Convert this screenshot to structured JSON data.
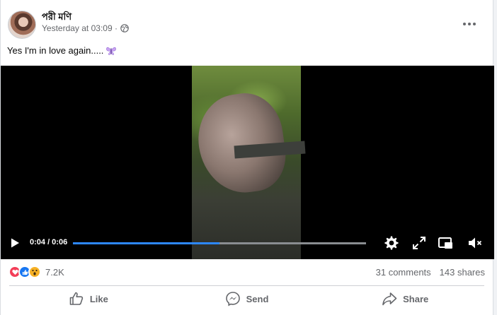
{
  "post": {
    "author": "পরী মণি",
    "timestamp": "Yesterday at 03:09 ·",
    "audience_icon": "globe-icon",
    "text": "Yes I'm in love again.....",
    "emoji": "butterfly"
  },
  "video": {
    "time": "0:04 / 0:06",
    "progress": 0.5,
    "buffered": 1.0,
    "colors": {
      "progress": "#2d88ff",
      "track": "#8a8d91"
    }
  },
  "engagement": {
    "reactions": [
      "love",
      "like",
      "wow"
    ],
    "reaction_count": "7.2K",
    "comments": "31 comments",
    "shares": "143 shares"
  },
  "actions": {
    "like": "Like",
    "send": "Send",
    "share": "Share"
  }
}
